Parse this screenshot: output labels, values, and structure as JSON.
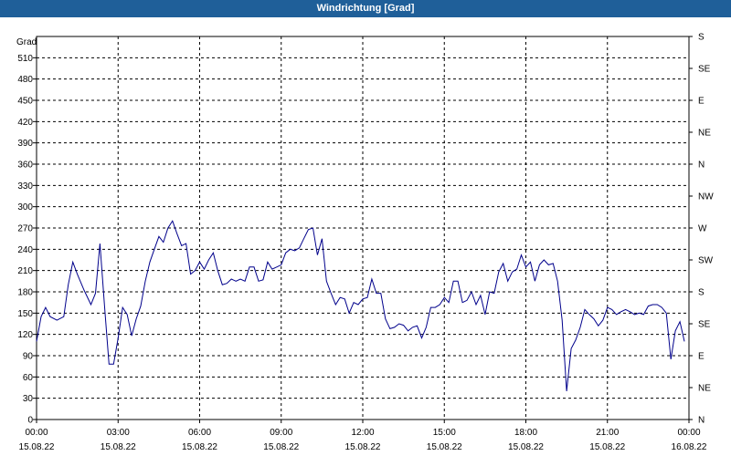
{
  "window": {
    "title": "Windrichtung [Grad]"
  },
  "chart_data": {
    "type": "line",
    "title": "Windrichtung [Grad]",
    "ylabel": "Grad",
    "ylim": [
      0,
      540
    ],
    "y_ticks": [
      0,
      30,
      60,
      90,
      120,
      150,
      180,
      210,
      240,
      270,
      300,
      330,
      360,
      390,
      420,
      450,
      480,
      510
    ],
    "right_axis_labels": [
      "N",
      "NE",
      "E",
      "SE",
      "S",
      "SW",
      "W",
      "NW",
      "N",
      "NE",
      "E",
      "SE",
      "S"
    ],
    "x_ticks": [
      {
        "time": "00:00",
        "date": "15.08.22"
      },
      {
        "time": "03:00",
        "date": "15.08.22"
      },
      {
        "time": "06:00",
        "date": "15.08.22"
      },
      {
        "time": "09:00",
        "date": "15.08.22"
      },
      {
        "time": "12:00",
        "date": "15.08.22"
      },
      {
        "time": "15:00",
        "date": "15.08.22"
      },
      {
        "time": "18:00",
        "date": "15.08.22"
      },
      {
        "time": "21:00",
        "date": "15.08.22"
      },
      {
        "time": "00:00",
        "date": "16.08.22"
      }
    ],
    "grid": true,
    "line_color": "#00008b",
    "x": [
      "00:00",
      "00:10",
      "00:20",
      "00:30",
      "00:45",
      "01:00",
      "01:10",
      "01:20",
      "01:30",
      "01:45",
      "02:00",
      "02:10",
      "02:20",
      "02:30",
      "02:40",
      "02:50",
      "03:00",
      "03:10",
      "03:20",
      "03:30",
      "03:40",
      "03:50",
      "04:00",
      "04:10",
      "04:20",
      "04:30",
      "04:40",
      "04:50",
      "05:00",
      "05:10",
      "05:20",
      "05:30",
      "05:40",
      "05:50",
      "06:00",
      "06:10",
      "06:20",
      "06:30",
      "06:40",
      "06:50",
      "07:00",
      "07:10",
      "07:20",
      "07:30",
      "07:40",
      "07:50",
      "08:00",
      "08:10",
      "08:20",
      "08:30",
      "08:40",
      "08:50",
      "09:00",
      "09:10",
      "09:20",
      "09:30",
      "09:40",
      "09:50",
      "10:00",
      "10:10",
      "10:20",
      "10:30",
      "10:40",
      "10:50",
      "11:00",
      "11:10",
      "11:20",
      "11:30",
      "11:40",
      "11:50",
      "12:00",
      "12:10",
      "12:20",
      "12:30",
      "12:40",
      "12:50",
      "13:00",
      "13:10",
      "13:20",
      "13:30",
      "13:40",
      "13:50",
      "14:00",
      "14:10",
      "14:20",
      "14:30",
      "14:40",
      "14:50",
      "15:00",
      "15:10",
      "15:20",
      "15:30",
      "15:40",
      "15:50",
      "16:00",
      "16:10",
      "16:20",
      "16:30",
      "16:40",
      "16:50",
      "17:00",
      "17:10",
      "17:20",
      "17:30",
      "17:40",
      "17:50",
      "18:00",
      "18:10",
      "18:20",
      "18:30",
      "18:40",
      "18:50",
      "19:00",
      "19:10",
      "19:20",
      "19:30",
      "19:40",
      "19:50",
      "20:00",
      "20:10",
      "20:20",
      "20:30",
      "20:40",
      "20:50",
      "21:00",
      "21:10",
      "21:20",
      "21:30",
      "21:40",
      "21:50",
      "22:00",
      "22:10",
      "22:20",
      "22:30",
      "22:40",
      "22:50",
      "23:00",
      "23:10",
      "23:20",
      "23:30",
      "23:40",
      "23:50"
    ],
    "y": [
      110,
      145,
      158,
      145,
      140,
      145,
      190,
      222,
      205,
      182,
      162,
      178,
      248,
      160,
      78,
      78,
      115,
      158,
      148,
      118,
      142,
      160,
      195,
      222,
      240,
      258,
      250,
      270,
      280,
      262,
      245,
      248,
      205,
      210,
      222,
      212,
      225,
      235,
      210,
      190,
      192,
      198,
      195,
      198,
      195,
      215,
      215,
      195,
      197,
      222,
      212,
      215,
      218,
      235,
      240,
      238,
      242,
      255,
      268,
      270,
      232,
      255,
      195,
      178,
      162,
      172,
      170,
      150,
      165,
      162,
      170,
      172,
      198,
      178,
      178,
      142,
      128,
      130,
      135,
      133,
      125,
      130,
      132,
      115,
      130,
      158,
      158,
      162,
      172,
      165,
      195,
      195,
      165,
      168,
      180,
      162,
      175,
      148,
      180,
      178,
      208,
      220,
      195,
      208,
      212,
      232,
      215,
      222,
      195,
      218,
      225,
      218,
      220,
      195,
      140,
      40,
      100,
      112,
      130,
      155,
      148,
      142,
      132,
      140,
      158,
      155,
      148,
      152,
      155,
      152,
      148,
      150,
      148,
      160,
      162,
      162,
      158,
      150,
      85,
      125,
      138,
      110,
      78
    ]
  }
}
